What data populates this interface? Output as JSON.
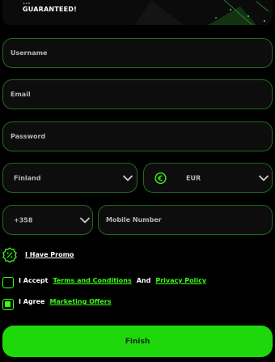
{
  "banner": {
    "line1": "...",
    "line2": "GUARANTEED!"
  },
  "form": {
    "username_placeholder": "Username",
    "email_placeholder": "Email",
    "password_placeholder": "Password",
    "country_value": "Finland",
    "currency_value": "EUR",
    "phone_code_value": "+358",
    "mobile_placeholder": "Mobile Number"
  },
  "promo": {
    "label": "I Have Promo"
  },
  "terms": {
    "prefix": "I Accept",
    "terms_link": "Terms and Conditions",
    "and": "And",
    "privacy_link": "Privacy Policy",
    "checked": false
  },
  "marketing": {
    "prefix": "I Agree",
    "link": "Marketing Offers",
    "checked": true
  },
  "finish_label": "Finish",
  "colors": {
    "accent": "#39ff14",
    "button": "#1ed80c",
    "field_border": "#1f6b1f",
    "background": "#000000"
  },
  "icons": {
    "currency": "euro-coin-icon",
    "promo": "percent-badge-icon",
    "dropdown": "chevron-down-icon"
  }
}
